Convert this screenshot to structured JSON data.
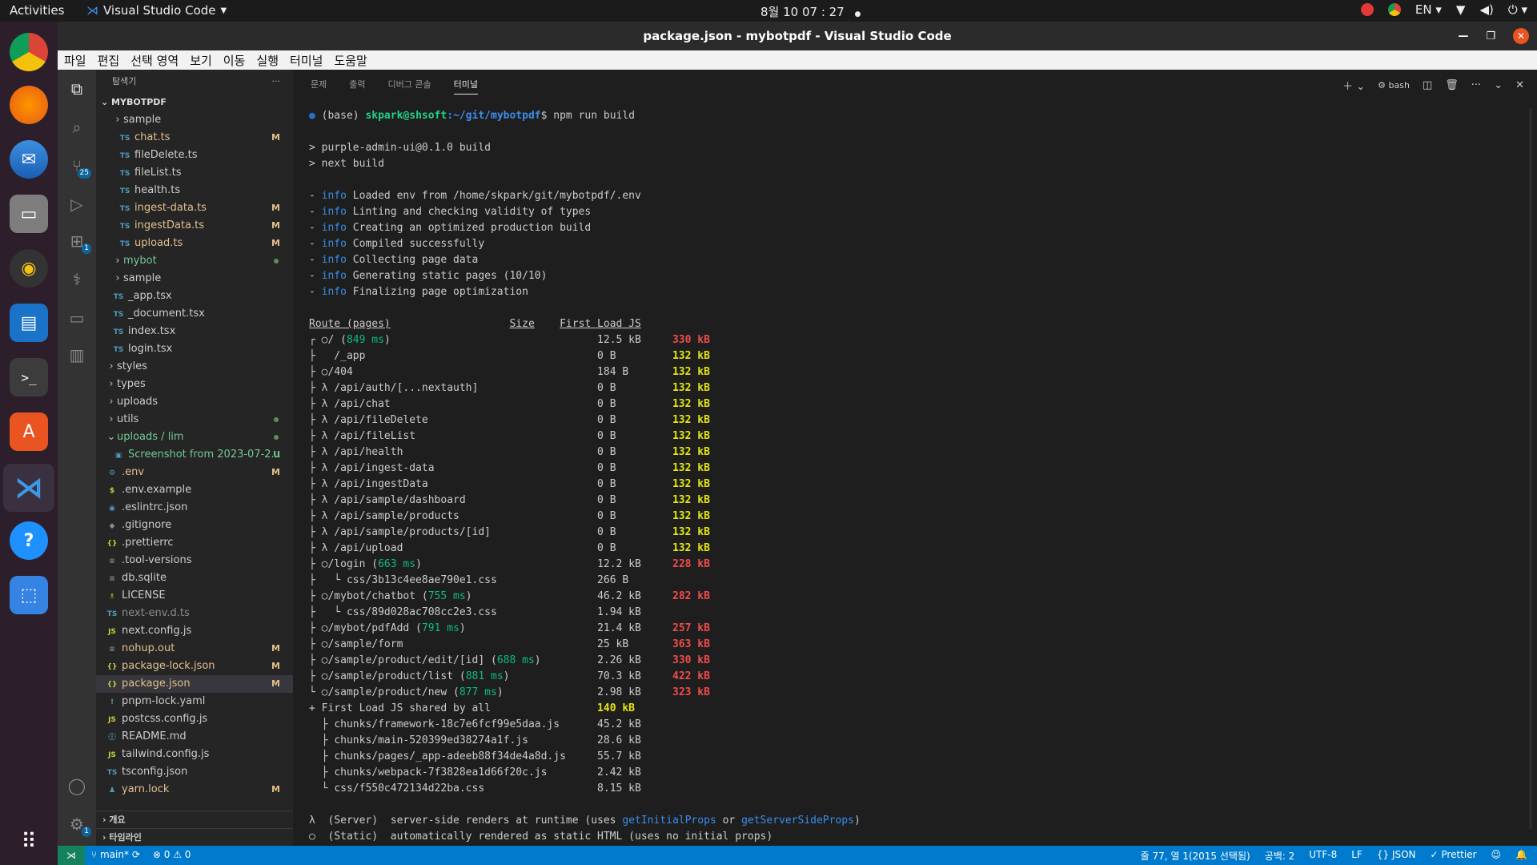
{
  "topbar": {
    "activities": "Activities",
    "app": "Visual Studio Code",
    "clock": "8월 10 07 : 27",
    "lang": "EN"
  },
  "window": {
    "title": "package.json - mybotpdf - Visual Studio Code"
  },
  "menu": [
    "파일",
    "편집",
    "선택 영역",
    "보기",
    "이동",
    "실행",
    "터미널",
    "도움말"
  ],
  "explorer": {
    "title": "탐색기",
    "project": "MYBOTPDF",
    "items": [
      {
        "depth": 2,
        "kind": "folder",
        "name": "sample",
        "status": ""
      },
      {
        "depth": 3,
        "kind": "ts",
        "name": "chat.ts",
        "status": "M"
      },
      {
        "depth": 3,
        "kind": "ts",
        "name": "fileDelete.ts",
        "status": ""
      },
      {
        "depth": 3,
        "kind": "ts",
        "name": "fileList.ts",
        "status": ""
      },
      {
        "depth": 3,
        "kind": "ts",
        "name": "health.ts",
        "status": ""
      },
      {
        "depth": 3,
        "kind": "ts",
        "name": "ingest-data.ts",
        "status": "M"
      },
      {
        "depth": 3,
        "kind": "ts",
        "name": "ingestData.ts",
        "status": "M"
      },
      {
        "depth": 3,
        "kind": "ts",
        "name": "upload.ts",
        "status": "M"
      },
      {
        "depth": 2,
        "kind": "folder",
        "name": "mybot",
        "status": "dot"
      },
      {
        "depth": 2,
        "kind": "folder",
        "name": "sample",
        "status": ""
      },
      {
        "depth": 2,
        "kind": "ts",
        "name": "_app.tsx",
        "status": ""
      },
      {
        "depth": 2,
        "kind": "ts",
        "name": "_document.tsx",
        "status": ""
      },
      {
        "depth": 2,
        "kind": "ts",
        "name": "index.tsx",
        "status": ""
      },
      {
        "depth": 2,
        "kind": "ts",
        "name": "login.tsx",
        "status": ""
      },
      {
        "depth": 1,
        "kind": "folder",
        "name": "styles",
        "status": ""
      },
      {
        "depth": 1,
        "kind": "folder",
        "name": "types",
        "status": ""
      },
      {
        "depth": 1,
        "kind": "folder",
        "name": "uploads",
        "status": ""
      },
      {
        "depth": 1,
        "kind": "folder",
        "name": "utils",
        "status": "dot"
      },
      {
        "depth": 1,
        "kind": "folderopen",
        "name": "uploads / lim",
        "status": "dot"
      },
      {
        "depth": 2,
        "kind": "img",
        "name": "Screenshot from 2023-07-2...",
        "status": "U"
      },
      {
        "depth": 1,
        "kind": "gear",
        "name": ".env",
        "status": "M"
      },
      {
        "depth": 1,
        "kind": "dollar",
        "name": ".env.example",
        "status": ""
      },
      {
        "depth": 1,
        "kind": "eslint",
        "name": ".eslintrc.json",
        "status": ""
      },
      {
        "depth": 1,
        "kind": "git",
        "name": ".gitignore",
        "status": ""
      },
      {
        "depth": 1,
        "kind": "json",
        "name": ".prettierrc",
        "status": ""
      },
      {
        "depth": 1,
        "kind": "lines",
        "name": ".tool-versions",
        "status": ""
      },
      {
        "depth": 1,
        "kind": "lines",
        "name": "db.sqlite",
        "status": ""
      },
      {
        "depth": 1,
        "kind": "license",
        "name": "LICENSE",
        "status": ""
      },
      {
        "depth": 1,
        "kind": "ts",
        "name": "next-env.d.ts",
        "status": ""
      },
      {
        "depth": 1,
        "kind": "js",
        "name": "next.config.js",
        "status": ""
      },
      {
        "depth": 1,
        "kind": "lines",
        "name": "nohup.out",
        "status": "M"
      },
      {
        "depth": 1,
        "kind": "json",
        "name": "package-lock.json",
        "status": "M"
      },
      {
        "depth": 1,
        "kind": "json",
        "name": "package.json",
        "status": "M",
        "selected": true
      },
      {
        "depth": 1,
        "kind": "yaml",
        "name": "pnpm-lock.yaml",
        "status": ""
      },
      {
        "depth": 1,
        "kind": "js",
        "name": "postcss.config.js",
        "status": ""
      },
      {
        "depth": 1,
        "kind": "info",
        "name": "README.md",
        "status": ""
      },
      {
        "depth": 1,
        "kind": "js",
        "name": "tailwind.config.js",
        "status": ""
      },
      {
        "depth": 1,
        "kind": "tsc",
        "name": "tsconfig.json",
        "status": ""
      },
      {
        "depth": 1,
        "kind": "yarn",
        "name": "yarn.lock",
        "status": "M"
      }
    ],
    "outline": "개요",
    "timeline": "타임라인"
  },
  "panel": {
    "tabs": [
      "문제",
      "출력",
      "디버그 콘솔",
      "터미널"
    ],
    "active_tab": "터미널",
    "shell": "bash"
  },
  "terminal": {
    "prompt_env": "(base) ",
    "prompt_user": "skpark@shsoft",
    "prompt_path": ":~/git/mybotpdf",
    "prompt_cmd": "$ npm run build",
    "script_lines": [
      "> purple-admin-ui@0.1.0 build",
      "> next build"
    ],
    "info_lines": [
      "Loaded env from /home/skpark/git/mybotpdf/.env",
      "Linting and checking validity of types",
      "Creating an optimized production build",
      "Compiled successfully",
      "Collecting page data",
      "Generating static pages (10/10)",
      "Finalizing page optimization"
    ],
    "headers": {
      "route": "Route (pages)",
      "size": "Size",
      "first_load": "First Load JS"
    },
    "routes": [
      {
        "p": "┌",
        "sym": "○",
        "path": "/",
        "ms": "849 ms",
        "size": "12.5 kB",
        "fl": "330 kB",
        "c": "r"
      },
      {
        "p": "├",
        "sym": " ",
        "path": " /_app",
        "ms": "",
        "size": "0 B",
        "fl": "132 kB",
        "c": "y"
      },
      {
        "p": "├",
        "sym": "○",
        "path": "/404",
        "ms": "",
        "size": "184 B",
        "fl": "132 kB",
        "c": "y"
      },
      {
        "p": "├",
        "sym": "λ",
        "path": " /api/auth/[...nextauth]",
        "ms": "",
        "size": "0 B",
        "fl": "132 kB",
        "c": "y"
      },
      {
        "p": "├",
        "sym": "λ",
        "path": " /api/chat",
        "ms": "",
        "size": "0 B",
        "fl": "132 kB",
        "c": "y"
      },
      {
        "p": "├",
        "sym": "λ",
        "path": " /api/fileDelete",
        "ms": "",
        "size": "0 B",
        "fl": "132 kB",
        "c": "y"
      },
      {
        "p": "├",
        "sym": "λ",
        "path": " /api/fileList",
        "ms": "",
        "size": "0 B",
        "fl": "132 kB",
        "c": "y"
      },
      {
        "p": "├",
        "sym": "λ",
        "path": " /api/health",
        "ms": "",
        "size": "0 B",
        "fl": "132 kB",
        "c": "y"
      },
      {
        "p": "├",
        "sym": "λ",
        "path": " /api/ingest-data",
        "ms": "",
        "size": "0 B",
        "fl": "132 kB",
        "c": "y"
      },
      {
        "p": "├",
        "sym": "λ",
        "path": " /api/ingestData",
        "ms": "",
        "size": "0 B",
        "fl": "132 kB",
        "c": "y"
      },
      {
        "p": "├",
        "sym": "λ",
        "path": " /api/sample/dashboard",
        "ms": "",
        "size": "0 B",
        "fl": "132 kB",
        "c": "y"
      },
      {
        "p": "├",
        "sym": "λ",
        "path": " /api/sample/products",
        "ms": "",
        "size": "0 B",
        "fl": "132 kB",
        "c": "y"
      },
      {
        "p": "├",
        "sym": "λ",
        "path": " /api/sample/products/[id]",
        "ms": "",
        "size": "0 B",
        "fl": "132 kB",
        "c": "y"
      },
      {
        "p": "├",
        "sym": "λ",
        "path": " /api/upload",
        "ms": "",
        "size": "0 B",
        "fl": "132 kB",
        "c": "y"
      },
      {
        "p": "├",
        "sym": "○",
        "path": "/login",
        "ms": "663 ms",
        "size": "12.2 kB",
        "fl": "228 kB",
        "c": "r"
      },
      {
        "p": "├",
        "sym": "",
        "path": "  └ css/3b13c4ee8ae790e1.css",
        "ms": "",
        "size": "266 B",
        "fl": "",
        "c": ""
      },
      {
        "p": "├",
        "sym": "○",
        "path": "/mybot/chatbot",
        "ms": "755 ms",
        "size": "46.2 kB",
        "fl": "282 kB",
        "c": "r"
      },
      {
        "p": "├",
        "sym": "",
        "path": "  └ css/89d028ac708cc2e3.css",
        "ms": "",
        "size": "1.94 kB",
        "fl": "",
        "c": ""
      },
      {
        "p": "├",
        "sym": "○",
        "path": "/mybot/pdfAdd",
        "ms": "791 ms",
        "size": "21.4 kB",
        "fl": "257 kB",
        "c": "r"
      },
      {
        "p": "├",
        "sym": "○",
        "path": "/sample/form",
        "ms": "",
        "size": "25 kB",
        "fl": "363 kB",
        "c": "r"
      },
      {
        "p": "├",
        "sym": "○",
        "path": "/sample/product/edit/[id]",
        "ms": "688 ms",
        "size": "2.26 kB",
        "fl": "330 kB",
        "c": "r"
      },
      {
        "p": "├",
        "sym": "○",
        "path": "/sample/product/list",
        "ms": "881 ms",
        "size": "70.3 kB",
        "fl": "422 kB",
        "c": "r"
      },
      {
        "p": "└",
        "sym": "○",
        "path": "/sample/product/new",
        "ms": "877 ms",
        "size": "2.98 kB",
        "fl": "323 kB",
        "c": "r"
      }
    ],
    "shared_label": "+ First Load JS shared by all",
    "shared_size": "140 kB",
    "chunks": [
      {
        "p": "├",
        "name": "chunks/framework-18c7e6fcf99e5daa.js",
        "size": "45.2 kB"
      },
      {
        "p": "├",
        "name": "chunks/main-520399ed38274a1f.js",
        "size": "28.6 kB"
      },
      {
        "p": "├",
        "name": "chunks/pages/_app-adeeb88f34de4a8d.js",
        "size": "55.7 kB"
      },
      {
        "p": "├",
        "name": "chunks/webpack-7f3828ea1d66f20c.js",
        "size": "2.42 kB"
      },
      {
        "p": "└",
        "name": "css/f550c472134d22ba.css",
        "size": "8.15 kB"
      }
    ],
    "legend_server_a": "λ  (Server)  server-side renders at runtime (uses ",
    "legend_server_fn1": "getInitialProps",
    "legend_server_or": " or ",
    "legend_server_fn2": "getServerSideProps",
    "legend_server_end": ")",
    "legend_static": "○  (Static)  automatically rendered as static HTML (uses no initial props)"
  },
  "status": {
    "branch": "main*",
    "errors": "0",
    "warnings": "0",
    "position": "줄 77, 열 1(2015 선택됨)",
    "spaces": "공백: 2",
    "encoding": "UTF-8",
    "eol": "LF",
    "language": "JSON",
    "prettier": "Prettier"
  },
  "colors": {
    "accent": "#007acc",
    "dock": "#2c1f2b",
    "sidebar": "#252526",
    "terminal_bg": "#1e1e1e"
  }
}
